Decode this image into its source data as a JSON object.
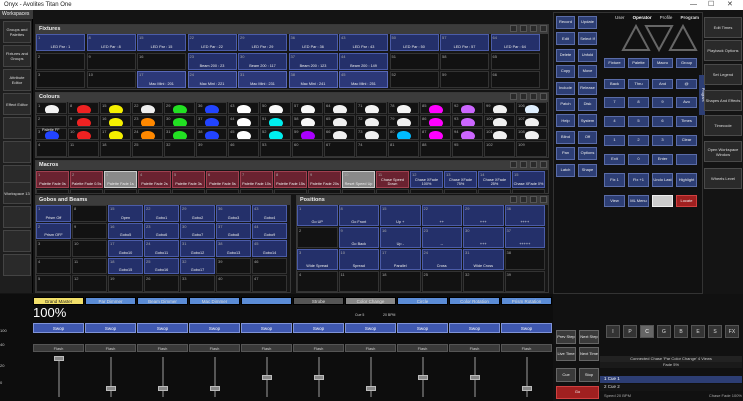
{
  "window": {
    "title": "Onyx - Avolites Titan One",
    "controls": [
      "—",
      "☐",
      "✕"
    ]
  },
  "sidebar": {
    "header": "Workspaces",
    "items": [
      "Groups and Palettes",
      "Fixtures and Groups",
      "Attribute Editor",
      "Effect Editor",
      "Workspace 13"
    ],
    "pages": "Pages"
  },
  "fixtures": {
    "title": "Fixtures",
    "row1": [
      {
        "n": "1",
        "l": "LED Par : 1"
      },
      {
        "n": "8",
        "l": "LED Par : 8"
      },
      {
        "n": "15",
        "l": "LED Par : 15"
      },
      {
        "n": "22",
        "l": "LED Par : 22"
      },
      {
        "n": "29",
        "l": "LED Par : 29"
      },
      {
        "n": "36",
        "l": "LED Par : 36"
      },
      {
        "n": "43",
        "l": "LED Par : 43"
      },
      {
        "n": "50",
        "l": "LED Par : 50"
      },
      {
        "n": "57",
        "l": "LED Par : 57"
      },
      {
        "n": "64",
        "l": "LED Par : 64"
      }
    ],
    "row2": [
      {
        "n": "2",
        "l": ""
      },
      {
        "n": "9",
        "l": ""
      },
      {
        "n": "16",
        "l": ""
      },
      {
        "n": "23",
        "l": "Beam 200 : 23"
      },
      {
        "n": "30",
        "l": "Beam 200 : 117"
      },
      {
        "n": "37",
        "l": "Beam 200 : 123"
      },
      {
        "n": "44",
        "l": "Beam 200 : 149"
      },
      {
        "n": "51",
        "l": ""
      },
      {
        "n": "58",
        "l": ""
      },
      {
        "n": "65",
        "l": ""
      }
    ],
    "row3": [
      {
        "n": "3",
        "l": ""
      },
      {
        "n": "10",
        "l": ""
      },
      {
        "n": "17",
        "l": "Mac Mini : 201"
      },
      {
        "n": "24",
        "l": "Mac Mini : 221"
      },
      {
        "n": "31",
        "l": "Mac Mini : 231"
      },
      {
        "n": "38",
        "l": "Mac Mini : 241"
      },
      {
        "n": "45",
        "l": "Mac Mini : 251"
      },
      {
        "n": "52",
        "l": ""
      },
      {
        "n": "59",
        "l": ""
      },
      {
        "n": "66",
        "l": ""
      }
    ]
  },
  "colours": {
    "title": "Colours",
    "row1": [
      {
        "n": "1",
        "c": "#f2f2f2"
      },
      {
        "n": "8",
        "c": "#ee2222"
      },
      {
        "n": "15",
        "c": "#f5f000"
      },
      {
        "n": "22",
        "c": "#eeeeee"
      },
      {
        "n": "29",
        "c": "#22e022"
      },
      {
        "n": "36",
        "c": "#2244ff"
      },
      {
        "n": "43",
        "c": "#ffffff"
      },
      {
        "n": "50",
        "c": "#fafafa"
      },
      {
        "n": "57",
        "c": "#f7f7f7"
      },
      {
        "n": "64",
        "c": "#f2f2f2"
      },
      {
        "n": "71",
        "c": "#f2f2f2"
      },
      {
        "n": "78",
        "c": "#f5f5f5"
      },
      {
        "n": "85",
        "c": "#ff00ff"
      },
      {
        "n": "92",
        "c": "#cc66ff"
      },
      {
        "n": "99",
        "c": "#f0f0f0"
      },
      {
        "n": "106",
        "c": "#e0f0ff"
      }
    ],
    "row2": [
      {
        "n": "2",
        "c": ""
      },
      {
        "n": "9",
        "c": "#ee2222"
      },
      {
        "n": "16",
        "c": "#f5f000"
      },
      {
        "n": "23",
        "c": "#ff8800"
      },
      {
        "n": "30",
        "c": "#22e022"
      },
      {
        "n": "37",
        "c": "#2244ff"
      },
      {
        "n": "44",
        "c": "#ffffff"
      },
      {
        "n": "51",
        "c": "#00eeee"
      },
      {
        "n": "58",
        "c": "#f7f7f7"
      },
      {
        "n": "65",
        "c": "#f0f0f0"
      },
      {
        "n": "72",
        "c": "#f0f0f0"
      },
      {
        "n": "79",
        "c": "#f0f0f0"
      },
      {
        "n": "86",
        "c": "#ff00ff"
      },
      {
        "n": "93",
        "c": "#cc66ff"
      },
      {
        "n": "100",
        "c": "#f0f0f0"
      },
      {
        "n": "107",
        "c": "#f0f0f0"
      }
    ],
    "label2": "Palette FF",
    "row3": [
      {
        "n": "3",
        "c": "#2244ff"
      },
      {
        "n": "10",
        "c": "#ee2222"
      },
      {
        "n": "17",
        "c": "#f5f000"
      },
      {
        "n": "24",
        "c": "#ff8800"
      },
      {
        "n": "31",
        "c": "#22e022"
      },
      {
        "n": "38",
        "c": "#2244ff"
      },
      {
        "n": "45",
        "c": "#ffffff"
      },
      {
        "n": "52",
        "c": "#00eeee"
      },
      {
        "n": "59",
        "c": "#aa00ff"
      },
      {
        "n": "66",
        "c": "#f0f0f0"
      },
      {
        "n": "73",
        "c": "#f0f0f0"
      },
      {
        "n": "80",
        "c": "#00bbff"
      },
      {
        "n": "87",
        "c": "#ff00ff"
      },
      {
        "n": "94",
        "c": "#cc66ff"
      },
      {
        "n": "101",
        "c": "#f0f0f0"
      },
      {
        "n": "108",
        "c": "#f0f0f0"
      }
    ],
    "row4": [
      "4",
      "11",
      "18",
      "25",
      "32",
      "39",
      "46",
      "53",
      "60",
      "67",
      "74",
      "81",
      "88",
      "95",
      "102",
      "109"
    ]
  },
  "macros": {
    "title": "Macros",
    "items": [
      {
        "n": "1",
        "l": "Palette Fade 0s",
        "t": "mac"
      },
      {
        "n": "2",
        "l": "Palette Fade 0.5s",
        "t": "mac"
      },
      {
        "n": "3",
        "l": "Palette Fade 1s",
        "t": "macsel"
      },
      {
        "n": "4",
        "l": "Palette Fade 2s",
        "t": "mac"
      },
      {
        "n": "5",
        "l": "Palette Fade 3s",
        "t": "mac"
      },
      {
        "n": "6",
        "l": "Palette Fade 5s",
        "t": "mac"
      },
      {
        "n": "7",
        "l": "Palette Fade 10s",
        "t": "mac"
      },
      {
        "n": "8",
        "l": "Palette Fade 15s",
        "t": "mac"
      },
      {
        "n": "9",
        "l": "Palette Fade 20s",
        "t": "mac"
      },
      {
        "n": "10",
        "l": "Reset Speed Up",
        "t": "macsel"
      },
      {
        "n": "11",
        "l": "Chase Speed Down",
        "t": "mac"
      },
      {
        "n": "12",
        "l": "Chase XFade 100%",
        "t": "fx"
      },
      {
        "n": "13",
        "l": "Chase XFade 75%",
        "t": "fx"
      },
      {
        "n": "14",
        "l": "Chase XFade 25%",
        "t": "fx"
      },
      {
        "n": "15",
        "l": "Chase XFade 0%",
        "t": "fx"
      }
    ],
    "row2": [
      "16",
      "17",
      "18",
      "19",
      "20",
      "21",
      "22",
      "23",
      "24",
      "25",
      "26",
      "27",
      "28",
      "29",
      "30"
    ]
  },
  "gobos": {
    "title": "Gobos and Beams",
    "rows": [
      [
        {
          "n": "1",
          "l": "Prism Off"
        },
        {
          "n": "8",
          "l": ""
        },
        {
          "n": "15",
          "l": "Open"
        },
        {
          "n": "22",
          "l": "Gobo1"
        },
        {
          "n": "29",
          "l": "Gobo2"
        },
        {
          "n": "36",
          "l": "Gobo3"
        },
        {
          "n": "43",
          "l": "Gobo4"
        }
      ],
      [
        {
          "n": "2",
          "l": "Prism OFF"
        },
        {
          "n": "9",
          "l": ""
        },
        {
          "n": "16",
          "l": "Gobo5"
        },
        {
          "n": "23",
          "l": "Gobo6"
        },
        {
          "n": "30",
          "l": "Gobo7"
        },
        {
          "n": "37",
          "l": "Gobo8"
        },
        {
          "n": "44",
          "l": "Gobo9"
        }
      ],
      [
        {
          "n": "3",
          "l": ""
        },
        {
          "n": "10",
          "l": ""
        },
        {
          "n": "17",
          "l": "Gobo10"
        },
        {
          "n": "24",
          "l": "Gobo11"
        },
        {
          "n": "31",
          "l": "Gobo12"
        },
        {
          "n": "38",
          "l": "Gobo13"
        },
        {
          "n": "45",
          "l": "Gobo14"
        }
      ],
      [
        {
          "n": "4",
          "l": ""
        },
        {
          "n": "11",
          "l": ""
        },
        {
          "n": "18",
          "l": "Gobo15"
        },
        {
          "n": "25",
          "l": "Gobo16"
        },
        {
          "n": "32",
          "l": "Gobo17"
        },
        {
          "n": "39",
          "l": ""
        },
        {
          "n": "46",
          "l": ""
        }
      ],
      [
        {
          "n": "5",
          "l": ""
        },
        {
          "n": "12",
          "l": ""
        },
        {
          "n": "19",
          "l": ""
        },
        {
          "n": "26",
          "l": ""
        },
        {
          "n": "33",
          "l": ""
        },
        {
          "n": "40",
          "l": ""
        },
        {
          "n": "47",
          "l": ""
        }
      ]
    ]
  },
  "positions": {
    "title": "Positions",
    "rows": [
      [
        {
          "n": "1",
          "l": "Go UP"
        },
        {
          "n": "8",
          "l": "Go Front"
        },
        {
          "n": "15",
          "l": "Up +"
        },
        {
          "n": "22",
          "l": "++"
        },
        {
          "n": "29",
          "l": "+++"
        },
        {
          "n": "36",
          "l": "++++"
        }
      ],
      [
        {
          "n": "2",
          "l": ""
        },
        {
          "n": "9",
          "l": "Go Back"
        },
        {
          "n": "16",
          "l": "Up -"
        },
        {
          "n": "23",
          "l": "--"
        },
        {
          "n": "30",
          "l": "+++"
        },
        {
          "n": "37",
          "l": "+++++"
        }
      ],
      [
        {
          "n": "3",
          "l": "Wide Spread"
        },
        {
          "n": "10",
          "l": "Spread"
        },
        {
          "n": "17",
          "l": "Parallel"
        },
        {
          "n": "24",
          "l": "Cross"
        },
        {
          "n": "31",
          "l": "Wide Cross"
        },
        {
          "n": "38",
          "l": ""
        }
      ],
      [
        {
          "n": "4",
          "l": ""
        },
        {
          "n": "11",
          "l": ""
        },
        {
          "n": "18",
          "l": ""
        },
        {
          "n": "25",
          "l": ""
        },
        {
          "n": "32",
          "l": ""
        },
        {
          "n": "39",
          "l": ""
        }
      ]
    ]
  },
  "keypad": {
    "col1": [
      "Record",
      "Edit",
      "Delete",
      "Copy",
      "Include",
      "Patch",
      "Help",
      "Blind",
      "Pan",
      "Latch"
    ],
    "col2": [
      "Update",
      "Select If",
      "Unfold",
      "Move",
      "Release",
      "Disk",
      "System",
      "Off",
      "Options",
      "Shape"
    ],
    "header": [
      "User",
      "Operator",
      "Profile",
      "Program"
    ],
    "attr": [
      "Fixture",
      "Palette",
      "Macro",
      "Group"
    ],
    "nav": [
      "Back",
      "Thru",
      "And",
      "@"
    ],
    "nums": [
      [
        "7",
        "8",
        "9",
        "Avo"
      ],
      [
        "4",
        "5",
        "6",
        "Times"
      ],
      [
        "1",
        "2",
        "3",
        "Clear"
      ],
      [
        "Exit",
        "0",
        "Enter",
        ""
      ]
    ],
    "fn": [
      "Fix 1",
      "Fix +1",
      "Undo Last",
      "Highlight"
    ],
    "bottom": [
      "View",
      "ML Menu",
      "",
      "Locate"
    ]
  },
  "right_bar": [
    "Edit Times",
    "Playback Options",
    "Set Legend",
    "Shapes And Effects",
    "Timecode",
    "Open Workspace Window",
    "Wheels Level"
  ],
  "faders": {
    "labels": [
      "Grand Master",
      "Par Dimmer",
      "Beam Dimmer",
      "Mac Dimmer",
      "",
      "Strobe",
      "Color Change",
      "Circle",
      "Color Rotation",
      "Prism Rotation"
    ],
    "active": [
      "#f2e06a",
      "#5b8cd6",
      "#5b8cd6",
      "#5b8cd6",
      "#5b8cd6",
      "#555555",
      "#888888",
      "#5b8cd6",
      "#5b8cd6",
      "#5b8cd6"
    ],
    "grand": "100%",
    "swop": "Swop",
    "flash": "Flash",
    "bpm": "Cue 5",
    "bpm2": "20 BPM",
    "levels": [
      "100",
      "40",
      "",
      "20",
      "0"
    ]
  },
  "cuelist": {
    "tabs": [
      "I",
      "P",
      "C",
      "G",
      "B",
      "E",
      "S",
      "FX"
    ],
    "buttons": [
      "Prev Step",
      "Next Step",
      "Live Time",
      "Next Time",
      "Cue",
      "Stop",
      "Go"
    ],
    "info": "Connected Chase 'Par Color Change'  4 Views",
    "fade": "Fade 5%",
    "cues": [
      "1  Cue 1",
      "2  Cue 2"
    ],
    "footer_left": "Speed 20 BPM",
    "footer_right": "Chase Fade  100%"
  }
}
